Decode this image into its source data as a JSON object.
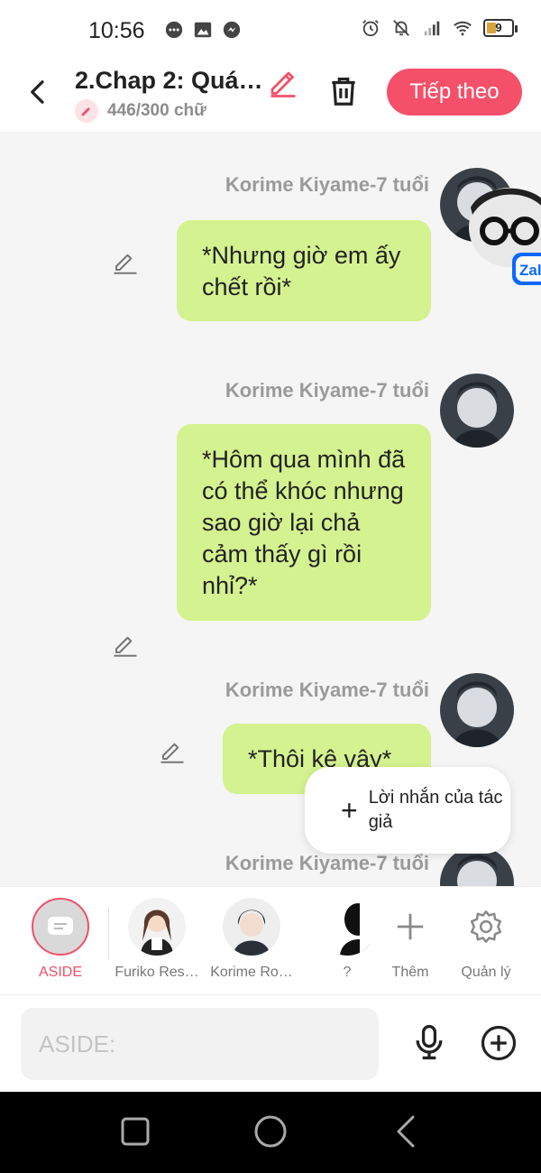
{
  "status_bar": {
    "time": "10:56",
    "battery": "9",
    "left_icons": [
      "chat-bubble-icon",
      "image-icon",
      "messenger-icon"
    ],
    "right_icons": [
      "alarm-icon",
      "bell-off-icon",
      "signal-icon",
      "wifi-icon"
    ]
  },
  "header": {
    "title": "2.Chap 2: Quá…",
    "word_count": "446/300 chữ",
    "next_label": "Tiếp theo",
    "accent_color": "#f4506a"
  },
  "messages": [
    {
      "sender": "Korime Kiyame-7 tuổi",
      "text": "*Nhưng giờ em ấy chết rồi*"
    },
    {
      "sender": "Korime Kiyame-7 tuổi",
      "text": "*Hôm qua mình đã có thể khóc nhưng sao giờ lại chả cảm thấy gì rồi nhỉ?*"
    },
    {
      "sender": "Korime Kiyame-7 tuổi",
      "text": "*Thôi kệ vậy*"
    },
    {
      "sender": "Korime Kiyame-7 tuổi",
      "text": ""
    }
  ],
  "bubble_color": "#d4f28f",
  "author_note": {
    "label": "Lời nhắn của tác giả"
  },
  "zalo_label": "Zal",
  "characters": {
    "aside_label": "ASIDE",
    "items": [
      {
        "label": "Furiko Res…"
      },
      {
        "label": "Korime Ro…"
      },
      {
        "label": "?"
      }
    ],
    "add_label": "Thêm",
    "manage_label": "Quản lý"
  },
  "input": {
    "placeholder": "ASIDE:",
    "value": ""
  }
}
